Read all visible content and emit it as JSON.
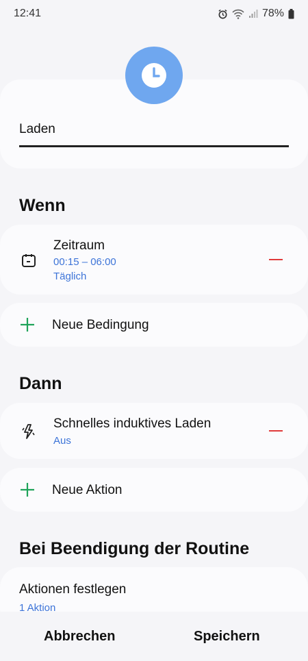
{
  "status_bar": {
    "time": "12:41",
    "battery": "78%",
    "icons": [
      "alarm-icon",
      "wifi-icon",
      "signal-icon",
      "battery-icon"
    ]
  },
  "routine": {
    "name": "Laden",
    "badge_icon": "clock-icon"
  },
  "wenn": {
    "title": "Wenn",
    "condition": {
      "icon": "calendar-icon",
      "title": "Zeitraum",
      "time": "00:15 – 06:00",
      "repeat": "Täglich"
    },
    "add_label": "Neue Bedingung"
  },
  "dann": {
    "title": "Dann",
    "action": {
      "icon": "bolt-icon",
      "title": "Schnelles induktives Laden",
      "state": "Aus"
    },
    "add_label": "Neue Aktion"
  },
  "end": {
    "title": "Bei Beendigung der Routine",
    "item_title": "Aktionen festlegen",
    "item_sub": "1 Aktion"
  },
  "buttons": {
    "cancel": "Abbrechen",
    "save": "Speichern"
  },
  "colors": {
    "accent_blue": "#3d74d8",
    "badge_blue": "#6fa7ef",
    "remove_red": "#e03a3a",
    "add_green": "#1fa35a"
  }
}
